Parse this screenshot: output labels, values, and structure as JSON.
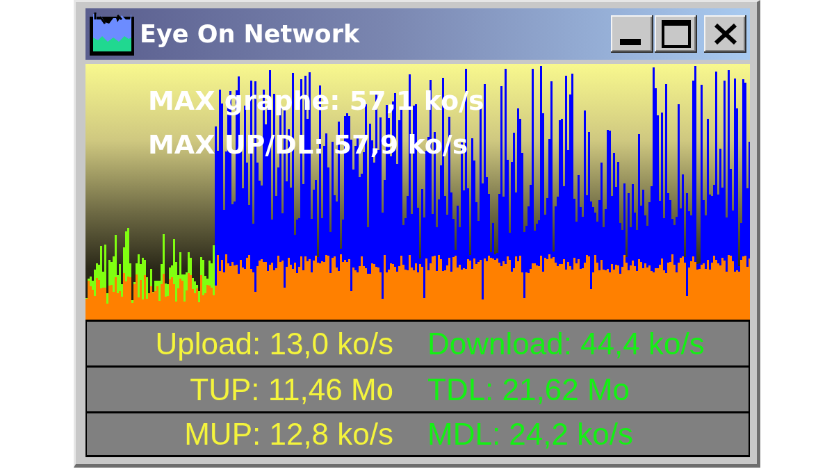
{
  "window": {
    "title": "Eye On Network"
  },
  "title_bar_buttons": [
    {
      "kind": "minimize"
    },
    {
      "kind": "maximize"
    },
    {
      "kind": "close"
    }
  ],
  "graph": {
    "labels": [
      "MAX graphe: 57,1 ko/s",
      "MAX UP/DL: 57,9 ko/s"
    ]
  },
  "stats": [
    {
      "upload": "Upload: 13,0 ko/s",
      "download": "Download: 44,4 ko/s"
    },
    {
      "upload": "TUP: 11,46 Mo",
      "download": "TDL: 21,62 Mo"
    },
    {
      "upload": "MUP: 12,8 ko/s",
      "download": "MDL: 24,2 ko/s"
    }
  ]
}
